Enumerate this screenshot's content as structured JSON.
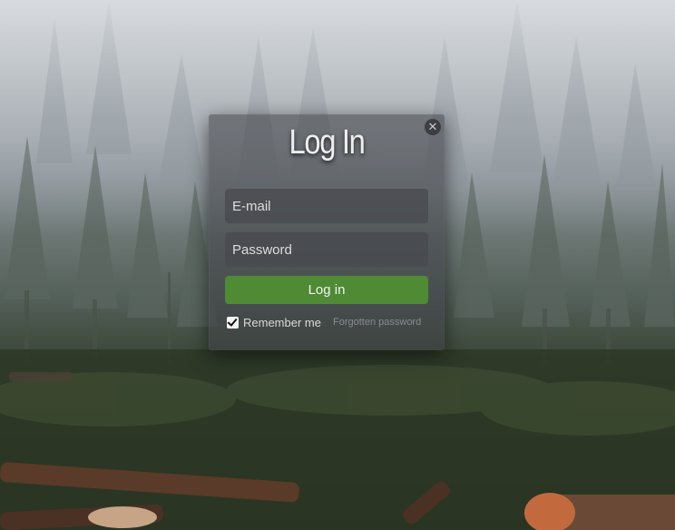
{
  "login_modal": {
    "title": "Log In",
    "close_icon": "close-icon",
    "email_placeholder": "E-mail",
    "password_placeholder": "Password",
    "submit_label": "Log in",
    "remember_label": "Remember me",
    "remember_checked": true,
    "forgot_label": "Forgotten password"
  },
  "colors": {
    "submit_button": "#4f8a35",
    "modal_background": "#3e4046"
  }
}
